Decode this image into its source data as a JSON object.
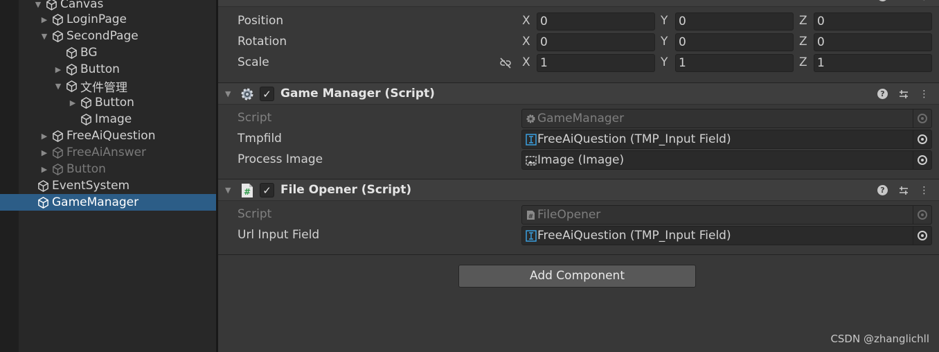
{
  "hierarchy": {
    "items": [
      {
        "label": "Canvas",
        "arrow": "down",
        "dim": false
      },
      {
        "label": "LoginPage",
        "arrow": "right",
        "dim": false
      },
      {
        "label": "SecondPage",
        "arrow": "down",
        "dim": false
      },
      {
        "label": "BG",
        "arrow": "none",
        "dim": false
      },
      {
        "label": "Button",
        "arrow": "right",
        "dim": false
      },
      {
        "label": "文件管理",
        "arrow": "down",
        "dim": false
      },
      {
        "label": "Button",
        "arrow": "right",
        "dim": false
      },
      {
        "label": "Image",
        "arrow": "none",
        "dim": false
      },
      {
        "label": "FreeAiQuestion",
        "arrow": "right",
        "dim": false
      },
      {
        "label": "FreeAiAnswer",
        "arrow": "right",
        "dim": true
      },
      {
        "label": "Button",
        "arrow": "right",
        "dim": true
      },
      {
        "label": "EventSystem",
        "arrow": "none",
        "dim": false
      },
      {
        "label": "GameManager",
        "arrow": "none",
        "dim": false,
        "selected": true
      }
    ]
  },
  "transform": {
    "position": {
      "label": "Position",
      "x_axis": "X",
      "y_axis": "Y",
      "z_axis": "Z",
      "x": "0",
      "y": "0",
      "z": "0"
    },
    "rotation": {
      "label": "Rotation",
      "x_axis": "X",
      "y_axis": "Y",
      "z_axis": "Z",
      "x": "0",
      "y": "0",
      "z": "0"
    },
    "scale": {
      "label": "Scale",
      "x_axis": "X",
      "y_axis": "Y",
      "z_axis": "Z",
      "x": "1",
      "y": "1",
      "z": "1"
    }
  },
  "game_manager": {
    "title": "Game Manager (Script)",
    "script_label": "Script",
    "script_value": "GameManager",
    "tmpfild_label": "Tmpfild",
    "tmpfild_value": "FreeAiQuestion (TMP_Input Field)",
    "process_image_label": "Process Image",
    "process_image_value": "Image (Image)"
  },
  "file_opener": {
    "title": "File Opener (Script)",
    "script_label": "Script",
    "script_value": "FileOpener",
    "url_label": "Url Input Field",
    "url_value": "FreeAiQuestion (TMP_Input Field)"
  },
  "add_component_label": "Add Component",
  "watermark": "CSDN @zhanglichll",
  "colors": {
    "selection": "#2c5d87",
    "inspector_bg": "#383838",
    "hierarchy_bg": "#282828"
  }
}
